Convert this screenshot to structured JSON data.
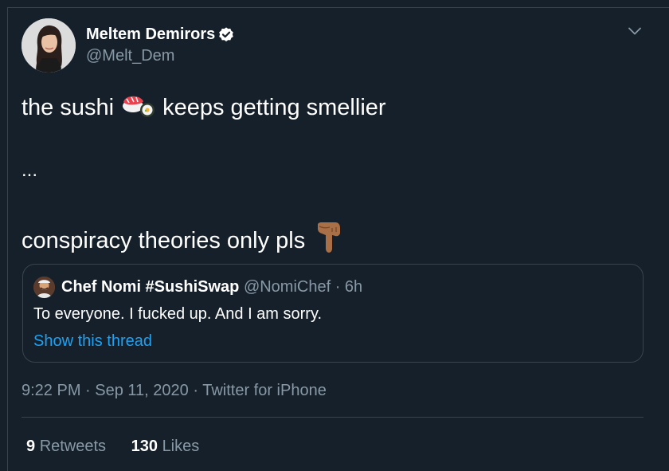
{
  "tweet": {
    "author": {
      "name": "Meltem Demirors",
      "handle": "@Melt_Dem",
      "verified": true
    },
    "text_lines": [
      "the sushi",
      "keeps getting smellier",
      "...",
      "conspiracy theories only pls"
    ],
    "emojis": [
      "sushi-emoji",
      "pointing-down-emoji"
    ],
    "quoted": {
      "name": "Chef Nomi #SushiSwap",
      "handle_time": "@NomiChef · 6h",
      "text": "To everyone. I fucked up. And I am sorry.",
      "thread_link": "Show this thread"
    },
    "meta": {
      "time": "9:22 PM",
      "sep1": " · ",
      "date": "Sep 11, 2020",
      "sep2": " · ",
      "source": "Twitter for iPhone"
    },
    "stats": {
      "retweets_count": "9",
      "retweets_label": "Retweets",
      "likes_count": "130",
      "likes_label": "Likes"
    }
  },
  "colors": {
    "background": "#15202b",
    "border": "#38444d",
    "secondary_text": "#8899a6",
    "link": "#1da1f2",
    "verified": "#ffffff"
  }
}
